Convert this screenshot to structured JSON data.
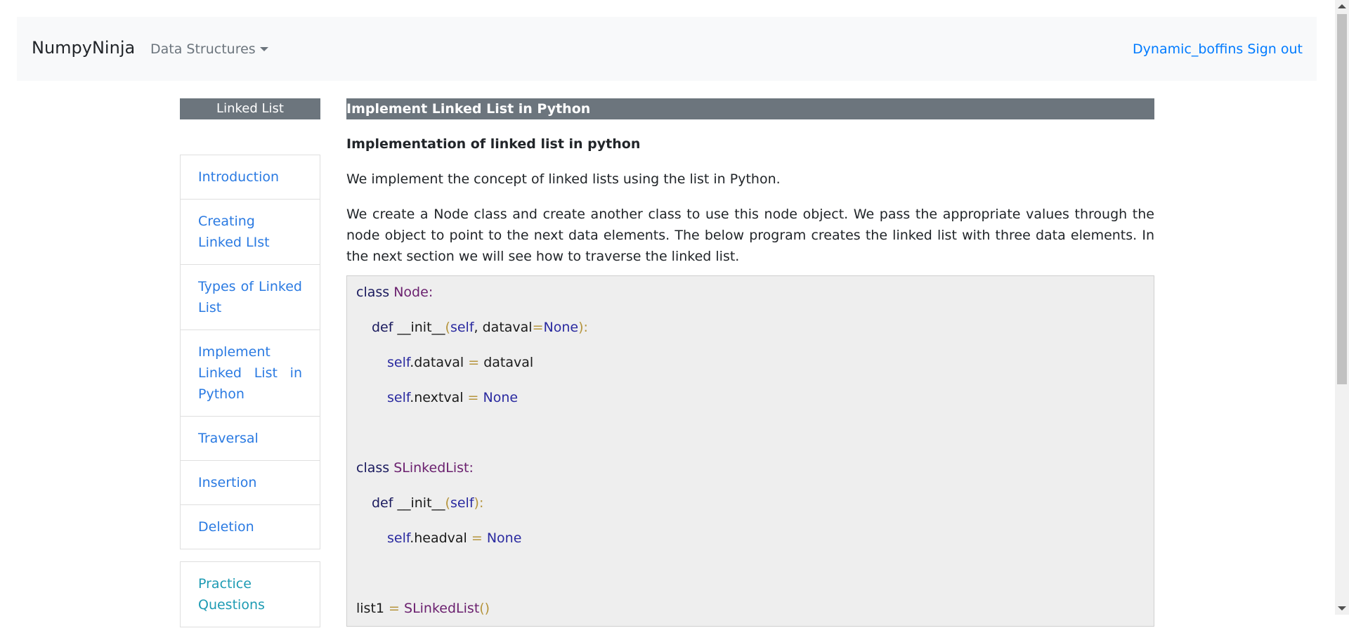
{
  "navbar": {
    "brand": "NumpyNinja",
    "dropdown_label": "Data Structures",
    "user": "Dynamic_boffins",
    "signout": "Sign out"
  },
  "sidebar": {
    "header": "Linked List",
    "items": [
      {
        "label": "Introduction"
      },
      {
        "label": "Creating Linked LIst"
      },
      {
        "label": "Types of Linked List"
      },
      {
        "label": "Implement Linked List in Python"
      },
      {
        "label": "Traversal"
      },
      {
        "label": "Insertion"
      },
      {
        "label": "Deletion"
      }
    ],
    "practice": "Practice Questions"
  },
  "main": {
    "title": "Implement Linked List in Python",
    "subtitle": "Implementation of linked list in python",
    "para1": "We implement the concept of linked lists using the list in Python.",
    "para2": "We create a Node class and create another class to use this node object. We pass the appropriate values through the node object to point to the next data elements. The below program creates the linked list with three data elements. In the next section we will see how to traverse the linked list."
  },
  "code": {
    "l1_a": "class ",
    "l1_b": "Node",
    "l1_c": ":",
    "l2_a": "def ",
    "l2_b": "__init__",
    "l2_c": "(",
    "l2_d": "self",
    "l2_e": ", ",
    "l2_f": "dataval",
    "l2_g": "=",
    "l2_h": "None",
    "l2_i": "):",
    "l3_a": "self",
    "l3_b": ".dataval ",
    "l3_c": "=",
    "l3_d": " dataval",
    "l4_a": "self",
    "l4_b": ".nextval ",
    "l4_c": "=",
    "l4_d": " None",
    "l5_a": "class ",
    "l5_b": "SLinkedList",
    "l5_c": ":",
    "l6_a": "def ",
    "l6_b": "__init__",
    "l6_c": "(",
    "l6_d": "self",
    "l6_e": "):",
    "l7_a": "self",
    "l7_b": ".headval ",
    "l7_c": "=",
    "l7_d": " None",
    "l8_a": "list1 ",
    "l8_b": "=",
    "l8_c": " SLinkedList",
    "l8_d": "()"
  }
}
